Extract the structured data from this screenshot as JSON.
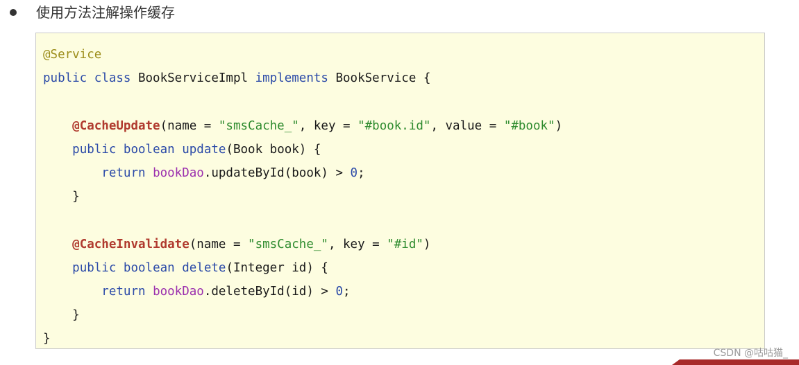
{
  "heading": {
    "bullet_text": "使用方法注解操作缓存"
  },
  "code": {
    "lines": [
      [
        {
          "t": "meta",
          "v": "@Service"
        }
      ],
      [
        {
          "t": "kw",
          "v": "public"
        },
        {
          "t": "plain",
          "v": " "
        },
        {
          "t": "kw",
          "v": "class"
        },
        {
          "t": "plain",
          "v": " BookServiceImpl "
        },
        {
          "t": "kw",
          "v": "implements"
        },
        {
          "t": "plain",
          "v": " BookService {"
        }
      ],
      [],
      [
        {
          "t": "plain",
          "v": "    "
        },
        {
          "t": "ann",
          "v": "@CacheUpdate"
        },
        {
          "t": "plain",
          "v": "(name = "
        },
        {
          "t": "str",
          "v": "\"smsCache_\""
        },
        {
          "t": "plain",
          "v": ", key = "
        },
        {
          "t": "str",
          "v": "\"#book.id\""
        },
        {
          "t": "plain",
          "v": ", value = "
        },
        {
          "t": "str",
          "v": "\"#book\""
        },
        {
          "t": "plain",
          "v": ")"
        }
      ],
      [
        {
          "t": "plain",
          "v": "    "
        },
        {
          "t": "kw",
          "v": "public"
        },
        {
          "t": "plain",
          "v": " "
        },
        {
          "t": "kw",
          "v": "boolean"
        },
        {
          "t": "plain",
          "v": " "
        },
        {
          "t": "fn",
          "v": "update"
        },
        {
          "t": "plain",
          "v": "(Book book) {"
        }
      ],
      [
        {
          "t": "plain",
          "v": "        "
        },
        {
          "t": "kw",
          "v": "return"
        },
        {
          "t": "plain",
          "v": " "
        },
        {
          "t": "var",
          "v": "bookDao"
        },
        {
          "t": "plain",
          "v": ".updateById(book) > "
        },
        {
          "t": "num",
          "v": "0"
        },
        {
          "t": "plain",
          "v": ";"
        }
      ],
      [
        {
          "t": "plain",
          "v": "    }"
        }
      ],
      [],
      [
        {
          "t": "plain",
          "v": "    "
        },
        {
          "t": "ann",
          "v": "@CacheInvalidate"
        },
        {
          "t": "plain",
          "v": "(name = "
        },
        {
          "t": "str",
          "v": "\"smsCache_\""
        },
        {
          "t": "plain",
          "v": ", key = "
        },
        {
          "t": "str",
          "v": "\"#id\""
        },
        {
          "t": "plain",
          "v": ")"
        }
      ],
      [
        {
          "t": "plain",
          "v": "    "
        },
        {
          "t": "kw",
          "v": "public"
        },
        {
          "t": "plain",
          "v": " "
        },
        {
          "t": "kw",
          "v": "boolean"
        },
        {
          "t": "plain",
          "v": " "
        },
        {
          "t": "fn",
          "v": "delete"
        },
        {
          "t": "plain",
          "v": "(Integer id) {"
        }
      ],
      [
        {
          "t": "plain",
          "v": "        "
        },
        {
          "t": "kw",
          "v": "return"
        },
        {
          "t": "plain",
          "v": " "
        },
        {
          "t": "var",
          "v": "bookDao"
        },
        {
          "t": "plain",
          "v": ".deleteById(id) > "
        },
        {
          "t": "num",
          "v": "0"
        },
        {
          "t": "plain",
          "v": ";"
        }
      ],
      [
        {
          "t": "plain",
          "v": "    }"
        }
      ],
      [
        {
          "t": "plain",
          "v": "}"
        }
      ]
    ]
  },
  "watermark": {
    "text": "CSDN @咕咕猫_"
  },
  "colors": {
    "code_background": "#fdfde0",
    "annotation": "#b03a2e",
    "keyword": "#2b4aa8",
    "string": "#2e8b2e",
    "field": "#9b2fae",
    "meta_annotation": "#9c8d1a"
  }
}
